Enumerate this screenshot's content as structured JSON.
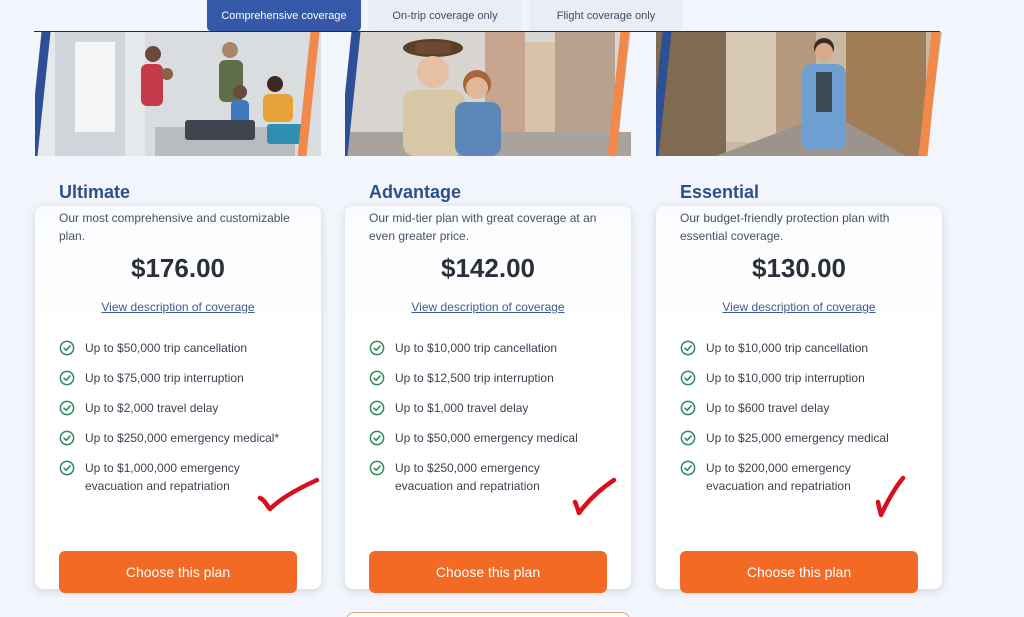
{
  "tabs": [
    {
      "label": "Comprehensive coverage",
      "active": true
    },
    {
      "label": "On-trip coverage only",
      "active": false
    },
    {
      "label": "Flight coverage only",
      "active": false
    }
  ],
  "plans": [
    {
      "name": "Ultimate",
      "description": "Our most comprehensive and customizable plan.",
      "price": "$176.00",
      "view_link": "View description of coverage",
      "features": [
        "Up to $50,000 trip cancellation",
        "Up to $75,000 trip interruption",
        "Up to $2,000 travel delay",
        "Up to $250,000 emergency medical*",
        "Up to $1,000,000 emergency evacuation and repatriation"
      ],
      "cta": "Choose this plan"
    },
    {
      "name": "Advantage",
      "description": "Our mid-tier plan with great coverage at an even greater price.",
      "price": "$142.00",
      "view_link": "View description of coverage",
      "features": [
        "Up to $10,000 trip cancellation",
        "Up to $12,500 trip interruption",
        "Up to $1,000 travel delay",
        "Up to $50,000 emergency medical",
        "Up to $250,000 emergency evacuation and repatriation"
      ],
      "cta": "Choose this plan"
    },
    {
      "name": "Essential",
      "description": "Our budget-friendly protection plan with essential coverage.",
      "price": "$130.00",
      "view_link": "View description of coverage",
      "features": [
        "Up to $10,000 trip cancellation",
        "Up to $10,000 trip interruption",
        "Up to $600 travel delay",
        "Up to $25,000 emergency medical",
        "Up to $200,000 emergency evacuation and repatriation"
      ],
      "cta": "Choose this plan"
    }
  ],
  "icons": {
    "feature": "check-circle-icon",
    "annotation": "red-checkmark-annotation"
  },
  "colors": {
    "tab_active": "#3558a8",
    "plan_name": "#2e4f8a",
    "cta": "#f26a24",
    "check": "#2e8a5e",
    "annotation": "#d8101e",
    "hero_stripe": "#f08a4b"
  }
}
